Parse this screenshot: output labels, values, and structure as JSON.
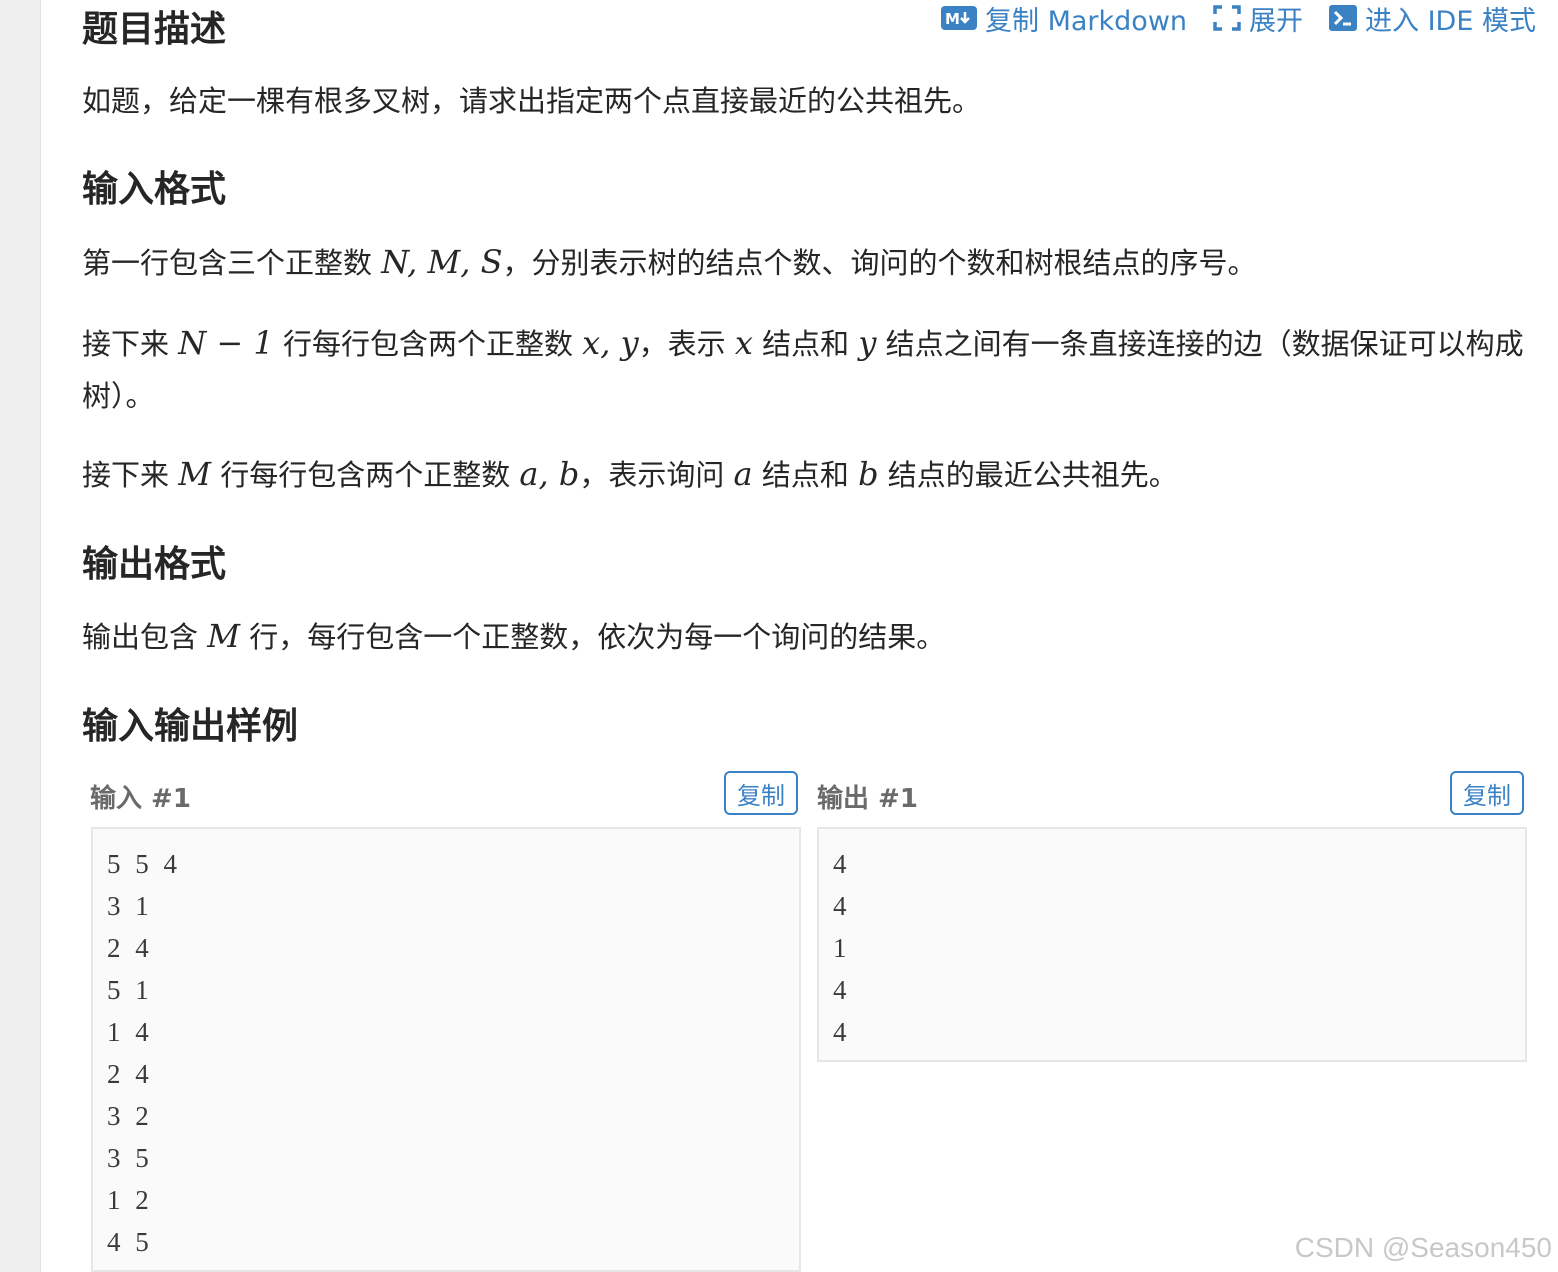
{
  "toolbar": {
    "copy_markdown": "复制 Markdown",
    "expand": "展开",
    "ide_mode": "进入 IDE 模式"
  },
  "sections": {
    "description_title": "题目描述",
    "description_text": "如题，给定一棵有根多叉树，请求出指定两个点直接最近的公共祖先。",
    "input_title": "输入格式",
    "input_p1_a": "第一行包含三个正整数 ",
    "input_p1_math": "N, M, S",
    "input_p1_b": "，分别表示树的结点个数、询问的个数和树根结点的序号。",
    "input_p2_a": "接下来 ",
    "input_p2_math": "N − 1",
    "input_p2_b": " 行每行包含两个正整数 ",
    "input_p2_math2": "x, y",
    "input_p2_c": "，表示 ",
    "input_p2_math3": "x",
    "input_p2_d": " 结点和 ",
    "input_p2_math4": "y",
    "input_p2_e": " 结点之间有一条直接连接的边（数据保证可以构成树）。",
    "input_p3_a": "接下来 ",
    "input_p3_math": "M",
    "input_p3_b": " 行每行包含两个正整数 ",
    "input_p3_math2": "a, b",
    "input_p3_c": "，表示询问 ",
    "input_p3_math3": "a",
    "input_p3_d": " 结点和 ",
    "input_p3_math4": "b",
    "input_p3_e": " 结点的最近公共祖先。",
    "output_title": "输出格式",
    "output_p_a": "输出包含 ",
    "output_p_math": "M",
    "output_p_b": " 行，每行包含一个正整数，依次为每一个询问的结果。",
    "samples_title": "输入输出样例"
  },
  "sample": {
    "input_label": "输入 #1",
    "output_label": "输出 #1",
    "copy_label": "复制",
    "input_lines": [
      "5 5 4",
      "3 1",
      "2 4",
      "5 1",
      "1 4",
      "2 4",
      "3 2",
      "3 5",
      "1 2",
      "4 5"
    ],
    "output_lines": [
      "4",
      "4",
      "1",
      "4",
      "4"
    ]
  },
  "watermark": "CSDN @Season450",
  "colors": {
    "accent": "#3b82c4",
    "text": "#262626",
    "code_bg": "#fafafa"
  }
}
